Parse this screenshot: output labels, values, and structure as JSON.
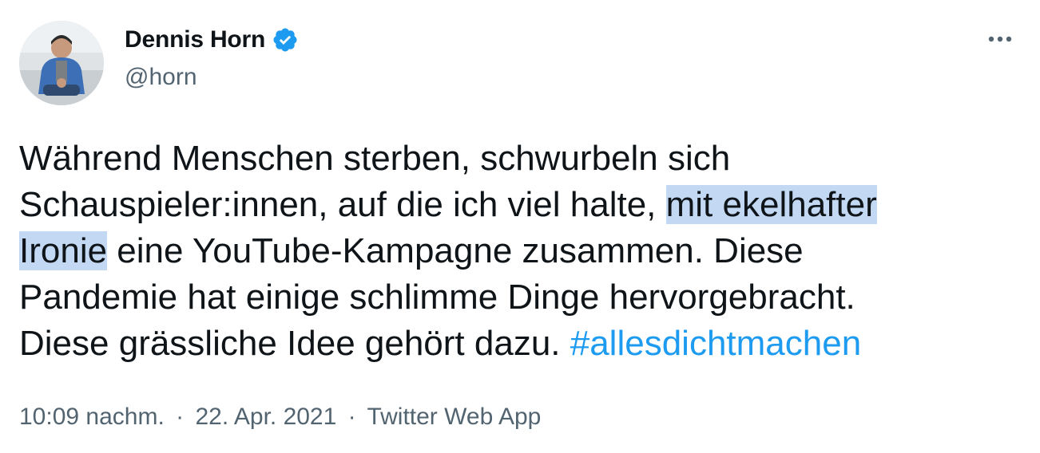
{
  "author": {
    "display_name": "Dennis Horn",
    "handle": "@horn",
    "verified": true
  },
  "tweet": {
    "lines": [
      {
        "segments": [
          {
            "text": "Während Menschen sterben, schwurbeln sich"
          }
        ]
      },
      {
        "segments": [
          {
            "text": "Schauspieler:innen, auf die ich viel halte, "
          },
          {
            "text": "mit ekelhafter",
            "highlight": true
          }
        ]
      },
      {
        "segments": [
          {
            "text": "Ironie",
            "highlight": true
          },
          {
            "text": " eine YouTube-Kampagne zusammen. Diese"
          }
        ]
      },
      {
        "segments": [
          {
            "text": "Pandemie hat einige schlimme Dinge hervorgebracht."
          }
        ]
      },
      {
        "segments": [
          {
            "text": "Diese grässliche Idee gehört dazu. "
          },
          {
            "text": "#allesdichtmachen",
            "hashtag": true
          }
        ]
      }
    ]
  },
  "meta": {
    "time": "10:09 nachm.",
    "separator": "·",
    "date": "22. Apr. 2021",
    "source": "Twitter Web App"
  },
  "icons": {
    "verified": "verified-badge-icon",
    "more": "more-options-icon"
  },
  "colors": {
    "text": "#0f1419",
    "secondary": "#536471",
    "link": "#1d9bf0",
    "highlight": "#c3d9f3",
    "verified": "#1d9bf0"
  }
}
